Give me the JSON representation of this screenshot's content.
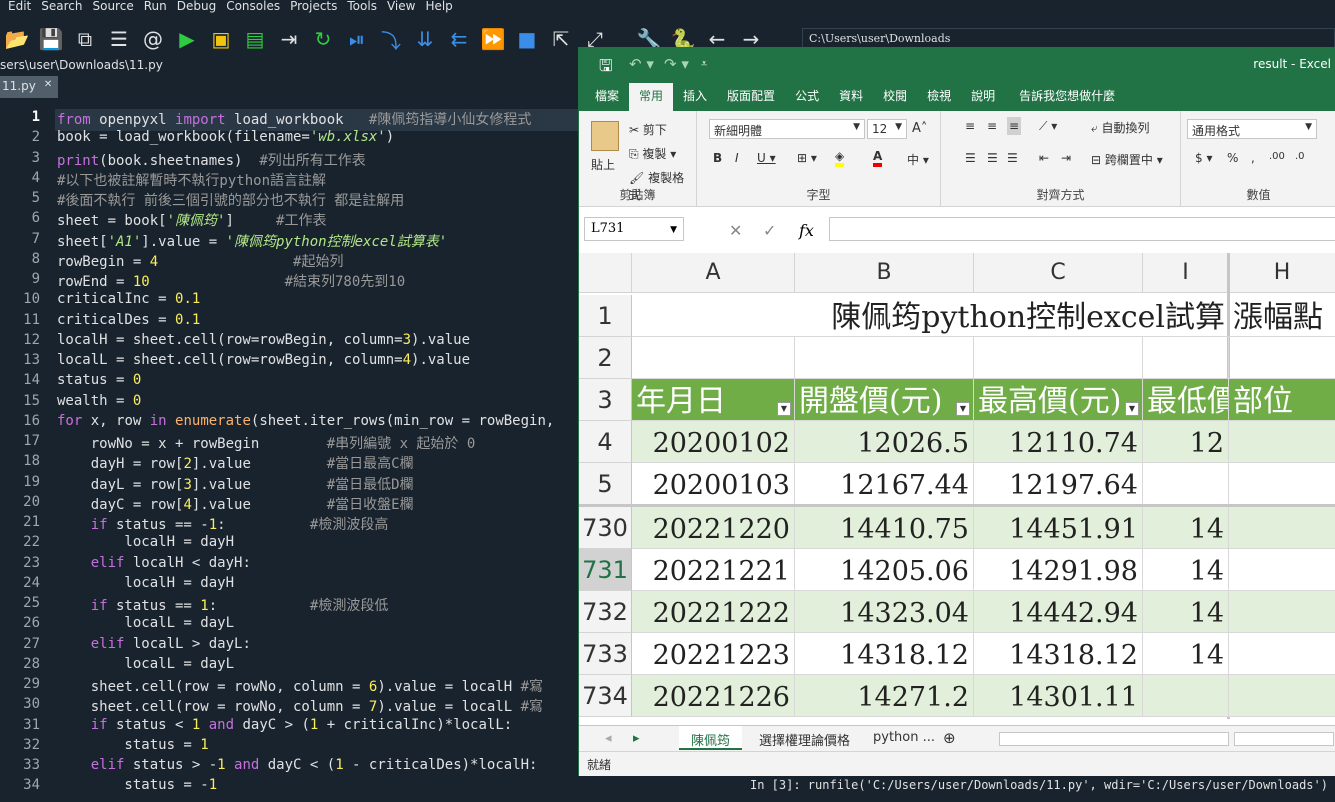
{
  "menu": [
    "Edit",
    "Search",
    "Source",
    "Run",
    "Debug",
    "Consoles",
    "Projects",
    "Tools",
    "View",
    "Help"
  ],
  "path_box": "C:\\Users\\user\\Downloads",
  "file_path": "sers\\user\\Downloads\\11.py",
  "file_tab": {
    "label": "11.py",
    "close": "✕"
  },
  "code_lines": [
    {
      "n": "1",
      "html": "<span class=\"kw\">from</span> openpyxl <span class=\"kw\">import</span> load_workbook   <span class=\"cm\">#陳佩筠指導小仙女修程式</span>"
    },
    {
      "n": "2",
      "html": "book = load_workbook(filename=<span class=\"it\">'wb.xlsx'</span>)"
    },
    {
      "n": "3",
      "html": "<span class=\"kw\">print</span>(book.sheetnames)  <span class=\"cm\">#列出所有工作表</span>"
    },
    {
      "n": "4",
      "html": "<span class=\"cm\">#以下也被註解暫時不執行python語言註解</span>"
    },
    {
      "n": "5",
      "html": "<span class=\"cm\">#後面不執行 前後三個引號的部分也不執行 都是註解用</span>"
    },
    {
      "n": "6",
      "html": "sheet = book[<span class=\"it\">'陳佩筠'</span>]     <span class=\"cm\">#工作表</span>"
    },
    {
      "n": "7",
      "html": "sheet[<span class=\"it\">'A1'</span>].value = <span class=\"it\">'陳佩筠python控制excel試算表'</span>"
    },
    {
      "n": "8",
      "html": "rowBegin = <span class=\"nm\">4</span>                <span class=\"cm\">#起始列</span>"
    },
    {
      "n": "9",
      "html": "rowEnd = <span class=\"nm\">10</span>                <span class=\"cm\">#結束列780先到10</span>"
    },
    {
      "n": "10",
      "html": "criticalInc = <span class=\"nm\">0.1</span>"
    },
    {
      "n": "11",
      "html": "criticalDes = <span class=\"nm\">0.1</span>"
    },
    {
      "n": "12",
      "html": "localH = sheet.cell(row=rowBegin, column=<span class=\"nm\">3</span>).value"
    },
    {
      "n": "13",
      "html": "localL = sheet.cell(row=rowBegin, column=<span class=\"nm\">4</span>).value"
    },
    {
      "n": "14",
      "html": "status = <span class=\"nm\">0</span>"
    },
    {
      "n": "15",
      "html": "wealth = <span class=\"nm\">0</span>"
    },
    {
      "n": "16",
      "html": "<span class=\"kw\">for</span> x, row <span class=\"kw\">in</span> <span class=\"bi\">enumerate</span>(sheet.iter_rows(min_row = rowBegin,"
    },
    {
      "n": "17",
      "html": "    rowNo = x + rowBegin        <span class=\"cm\">#串列編號 x 起始於 0</span>"
    },
    {
      "n": "18",
      "html": "    dayH = row[<span class=\"nm\">2</span>].value         <span class=\"cm\">#當日最高C欄</span>"
    },
    {
      "n": "19",
      "html": "    dayL = row[<span class=\"nm\">3</span>].value         <span class=\"cm\">#當日最低D欄</span>"
    },
    {
      "n": "20",
      "html": "    dayC = row[<span class=\"nm\">4</span>].value         <span class=\"cm\">#當日收盤E欄</span>"
    },
    {
      "n": "21",
      "html": "    <span class=\"kw\">if</span> status == -<span class=\"nm\">1</span>:          <span class=\"cm\">#檢測波段高</span>"
    },
    {
      "n": "22",
      "html": "        localH = dayH"
    },
    {
      "n": "23",
      "html": "    <span class=\"kw\">elif</span> localH &lt; dayH:"
    },
    {
      "n": "24",
      "html": "        localH = dayH"
    },
    {
      "n": "25",
      "html": "    <span class=\"kw\">if</span> status == <span class=\"nm\">1</span>:           <span class=\"cm\">#檢測波段低</span>"
    },
    {
      "n": "26",
      "html": "        localL = dayL"
    },
    {
      "n": "27",
      "html": "    <span class=\"kw\">elif</span> localL &gt; dayL:"
    },
    {
      "n": "28",
      "html": "        localL = dayL"
    },
    {
      "n": "29",
      "html": "    sheet.cell(row = rowNo, column = <span class=\"nm\">6</span>).value = localH <span class=\"cm\">#寫</span>"
    },
    {
      "n": "30",
      "html": "    sheet.cell(row = rowNo, column = <span class=\"nm\">7</span>).value = localL <span class=\"cm\">#寫</span>"
    },
    {
      "n": "31",
      "html": "    <span class=\"kw\">if</span> status &lt; <span class=\"nm\">1</span> <span class=\"kw\">and</span> dayC &gt; (<span class=\"nm\">1</span> + criticalInc)*localL:"
    },
    {
      "n": "32",
      "html": "        status = <span class=\"nm\">1</span>"
    },
    {
      "n": "33",
      "html": "    <span class=\"kw\">elif</span> status &gt; -<span class=\"nm\">1</span> <span class=\"kw\">and</span> dayC &lt; (<span class=\"nm\">1</span> - criticalDes)*localH:"
    },
    {
      "n": "34",
      "html": "        status = -<span class=\"nm\">1</span>"
    }
  ],
  "excel": {
    "doc_name": "result  -  Excel",
    "tabs": [
      "檔案",
      "常用",
      "插入",
      "版面配置",
      "公式",
      "資料",
      "校閱",
      "檢視",
      "說明",
      "告訴我您想做什麼"
    ],
    "active_tab": "常用",
    "ribbon": {
      "cut": "剪下",
      "copy": "複製",
      "format_painter": "複製格式",
      "paste": "貼上",
      "clipboard": "剪貼簿",
      "font_name": "新細明體",
      "font_size": "12",
      "font": "字型",
      "wrap": "自動換列",
      "merge": "跨欄置中",
      "alignment": "對齊方式",
      "number_format": "通用格式",
      "number": "數值"
    },
    "name_box": "L731",
    "columns": [
      "A",
      "B",
      "C",
      "I",
      "H"
    ],
    "title_cell": "陳佩筠python控制excel試算",
    "title_cell_h": "漲幅點",
    "headers": [
      "年月日",
      "開盤價(元)",
      "最高價(元)",
      "最低價",
      "部位"
    ],
    "rows": [
      {
        "r": "4",
        "a": "20200102",
        "b": "12026.5",
        "c": "12110.74",
        "d": "12"
      },
      {
        "r": "5",
        "a": "20200103",
        "b": "12167.44",
        "c": "12197.64",
        "d": ""
      },
      {
        "r": "730",
        "a": "20221220",
        "b": "14410.75",
        "c": "14451.91",
        "d": "14"
      },
      {
        "r": "731",
        "a": "20221221",
        "b": "14205.06",
        "c": "14291.98",
        "d": "14"
      },
      {
        "r": "732",
        "a": "20221222",
        "b": "14323.04",
        "c": "14442.94",
        "d": "14"
      },
      {
        "r": "733",
        "a": "20221223",
        "b": "14318.12",
        "c": "14318.12",
        "d": "14"
      },
      {
        "r": "734",
        "a": "20221226",
        "b": "14271.2",
        "c": "14301.11",
        "d": ""
      }
    ],
    "sheets": [
      "陳佩筠",
      "選擇權理論價格",
      "python ..."
    ],
    "status": "就緒"
  },
  "console": "In [3]: runfile('C:/Users/user/Downloads/11.py', wdir='C:/Users/user/Downloads')"
}
